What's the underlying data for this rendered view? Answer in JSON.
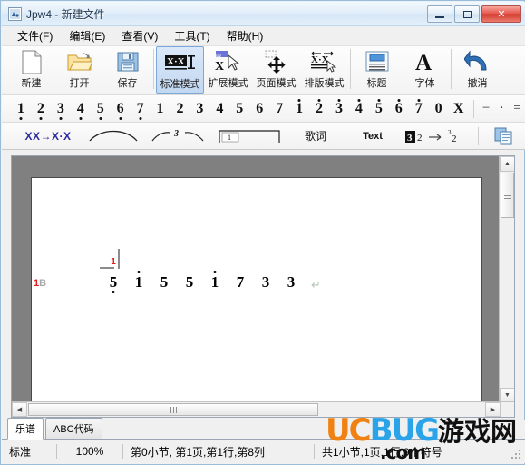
{
  "window": {
    "title": "Jpw4 - 新建文件",
    "icon": "app-icon",
    "minimize_label": "最小化",
    "maximize_label": "最大化",
    "close_label": "✕"
  },
  "menu": {
    "items": [
      {
        "label": "文件(F)",
        "name": "menu-file"
      },
      {
        "label": "编辑(E)",
        "name": "menu-edit"
      },
      {
        "label": "查看(V)",
        "name": "menu-view"
      },
      {
        "label": "工具(T)",
        "name": "menu-tools"
      },
      {
        "label": "帮助(H)",
        "name": "menu-help"
      }
    ]
  },
  "toolbar_main": {
    "buttons": [
      {
        "label": "新建",
        "icon": "new-document-icon"
      },
      {
        "label": "打开",
        "icon": "open-folder-icon"
      },
      {
        "label": "保存",
        "icon": "save-floppy-icon"
      },
      {
        "label": "标准模式",
        "icon": "standard-mode-icon",
        "selected": true
      },
      {
        "label": "扩展模式",
        "icon": "extended-mode-icon"
      },
      {
        "label": "页面模式",
        "icon": "page-mode-icon"
      },
      {
        "label": "排版模式",
        "icon": "layout-mode-icon"
      },
      {
        "label": "标题",
        "icon": "title-icon"
      },
      {
        "label": "字体",
        "icon": "font-icon"
      },
      {
        "label": "撤消",
        "icon": "undo-arrow-icon"
      }
    ]
  },
  "toolbar_notes": {
    "low_octave": [
      "1",
      "2",
      "3",
      "4",
      "5",
      "6",
      "7"
    ],
    "mid_octave": [
      "1",
      "2",
      "3",
      "4",
      "5",
      "6",
      "7"
    ],
    "high_octave": [
      "1",
      "2",
      "3",
      "4",
      "5",
      "6",
      "7"
    ],
    "rest": "0",
    "mute": "X",
    "symbols": [
      "−",
      "·",
      "="
    ]
  },
  "toolbar_marks": {
    "items": [
      {
        "label": "XX→X·X",
        "name": "dotted-rhythm-button",
        "type": "text"
      },
      {
        "label": "",
        "name": "slur-button",
        "type": "slur"
      },
      {
        "label": "3",
        "name": "triplet-button",
        "type": "triplet"
      },
      {
        "label": "1",
        "name": "repeat-bracket-button",
        "type": "bracket"
      },
      {
        "label": "歌词",
        "name": "lyrics-button",
        "type": "label"
      },
      {
        "label": "Text",
        "name": "text-button",
        "type": "label-en"
      },
      {
        "label": "3 2 → ³₂",
        "name": "time-signature-button",
        "type": "timesig"
      },
      {
        "label": "",
        "name": "copy-button",
        "type": "copy"
      }
    ],
    "timesig": {
      "boxed": "3",
      "plain": "2",
      "arrow": "→",
      "sup": "3",
      "sub": "2"
    }
  },
  "document": {
    "row_marker": {
      "number": "1",
      "letter": "B"
    },
    "cursor_measure_label": "1",
    "notes": [
      {
        "value": "5",
        "octave": "low",
        "cursor": true
      },
      {
        "value": "1",
        "octave": "high",
        "cursor": false
      },
      {
        "value": "5",
        "octave": "mid",
        "cursor": false
      },
      {
        "value": "5",
        "octave": "mid",
        "cursor": false
      },
      {
        "value": "1",
        "octave": "high",
        "cursor": false
      },
      {
        "value": "7",
        "octave": "mid",
        "cursor": false
      },
      {
        "value": "3",
        "octave": "mid",
        "cursor": false
      },
      {
        "value": "3",
        "octave": "mid",
        "cursor": false
      }
    ],
    "paragraph_mark": "↵"
  },
  "tabs": [
    {
      "label": "乐谱",
      "active": true
    },
    {
      "label": "ABC代码",
      "active": false
    }
  ],
  "statusbar": {
    "mode": "标准",
    "zoom": "100%",
    "position": "第0小节, 第1页,第1行,第8列",
    "totals": "共1小节,1页,1行,9个符号"
  },
  "watermark": {
    "uc": "UC",
    "bug": "BUG",
    "cn": "游戏网",
    "domain": ".com"
  },
  "colors": {
    "accent_red": "#e01b1b",
    "selection_blue": "#7da7d9",
    "page_bg": "#808080",
    "wm_orange": "#f08113",
    "wm_blue": "#2aa3e8"
  }
}
